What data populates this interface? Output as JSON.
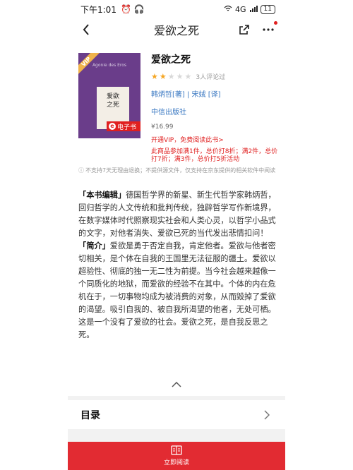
{
  "status_bar": {
    "time": "下午1:01",
    "signal_text": "4G",
    "battery": "11"
  },
  "nav": {
    "title": "爱欲之死"
  },
  "book": {
    "title": "爱欲之死",
    "cover_en_title": "Agonie des Eros",
    "cover_cn_title_line1": "爱欲",
    "cover_cn_title_line2": "之死",
    "cover_vip": "VIP",
    "ebook_tag": "电子书",
    "rating": 2,
    "rating_max": 5,
    "review_count": "3人评论过",
    "authors": "韩炳哲[著] | 宋娀 [译]",
    "publisher": "中信出版社",
    "price": "¥16.99",
    "vip_line": "开通VIP，免费阅读此书>",
    "promo": "此商品参加满1件，总价打8折；满2件，总价打7折；满3件，总价打5折活动"
  },
  "notice": "不支持7天无理由退换；不提供源文件，仅支持在京东提供的相关软件中阅读",
  "description": {
    "editor_tag": "「本书编辑」",
    "editor_text": "德国哲学界的新星、新生代哲学家韩炳哲，回归哲学的人文传统和批判传统，独辟哲学写作新境界，在数字媒体时代照察现实社会和人类心灵，以哲学小品式的文字，对他者消失、爱欲已死的当代发出悲情扣问！",
    "intro_tag": "「简介」",
    "intro_text": "爱欲是勇于否定自我，肯定他者。爱欲与他者密切相关，是个体在自我的王国里无法征服的疆土。爱欲以超验性、彻底的独一无二性为前提。当今社会越来越像一个同质化的地狱，而爱欲的经验不在其中。个体的内在危机在于，一切事物均成为被消费的对象，从而毁掉了爱欲的渴望。吸引自我的、被自我所渴望的他者，无处可栖。这是一个没有了爱欲的社会。爱欲之死，是自我反思之死。"
  },
  "toc": {
    "label": "目录"
  },
  "read_button": {
    "label": "立即阅读"
  },
  "colors": {
    "accent_red": "#e22b32",
    "link_blue": "#3a78c2",
    "star": "#f5a623",
    "cover_purple": "#6a3d8a"
  },
  "icons": [
    "back-arrow-icon",
    "share-icon",
    "more-icon",
    "star-icon",
    "info-icon",
    "chevron-up-icon",
    "chevron-right-icon",
    "book-open-icon"
  ]
}
